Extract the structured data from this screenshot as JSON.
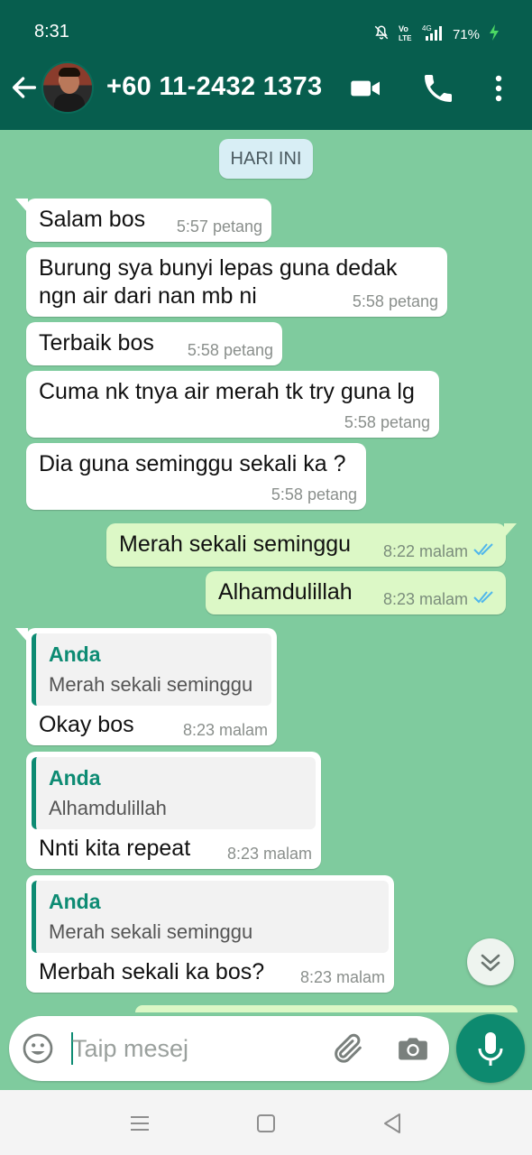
{
  "status_bar": {
    "time": "8:31",
    "battery": "71%",
    "icons": [
      "mute-notifications-icon",
      "volte-icon",
      "4g-signal-icon",
      "battery-charging-icon"
    ]
  },
  "header": {
    "contact_name": "+60 11-2432 1373",
    "icons": [
      "back-arrow-icon",
      "video-call-icon",
      "voice-call-icon",
      "more-options-icon"
    ]
  },
  "chat": {
    "date_chip": "HARI INI",
    "messages": [
      {
        "direction": "in",
        "text": "Salam bos",
        "time": "5:57 petang"
      },
      {
        "direction": "in",
        "text": "Burung sya bunyi lepas guna dedak\nngn air dari nan mb ni",
        "time": "5:58 petang"
      },
      {
        "direction": "in",
        "text": "Terbaik bos",
        "time": "5:58 petang"
      },
      {
        "direction": "in",
        "text": "Cuma nk tnya air merah tk try guna lg",
        "time": "5:58 petang"
      },
      {
        "direction": "in",
        "text": "Dia guna seminggu sekali ka ?",
        "time": "5:58 petang"
      },
      {
        "direction": "out",
        "text": "Merah sekali seminggu",
        "time": "8:22 malam",
        "status": "read"
      },
      {
        "direction": "out",
        "text": "Alhamdulillah",
        "time": "8:23 malam",
        "status": "read"
      },
      {
        "direction": "in",
        "quote": {
          "author": "Anda",
          "text": "Merah sekali seminggu"
        },
        "text": "Okay bos",
        "time": "8:23 malam"
      },
      {
        "direction": "in",
        "quote": {
          "author": "Anda",
          "text": "Alhamdulillah"
        },
        "text": "Nnti kita repeat",
        "time": "8:23 malam"
      },
      {
        "direction": "in",
        "quote": {
          "author": "Anda",
          "text": "Merah sekali seminggu"
        },
        "text": "Merbah sekali ka bos?",
        "time": "8:23 malam"
      }
    ]
  },
  "composer": {
    "placeholder": "Taip mesej",
    "value": "",
    "icons": [
      "emoji-icon",
      "attach-icon",
      "camera-icon",
      "mic-icon"
    ]
  },
  "colors": {
    "header_bg": "#075e4e",
    "chat_bg": "#7fcb9e",
    "outgoing_bubble": "#dcf8c6",
    "accent": "#0d8b73",
    "read_ticks": "#4fb6ec"
  }
}
